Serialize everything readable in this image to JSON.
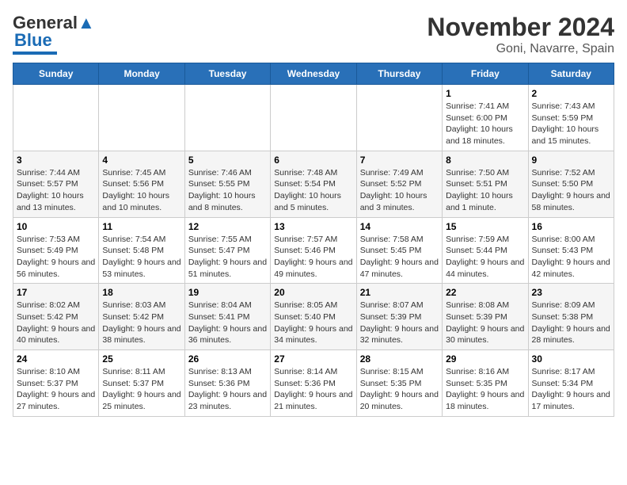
{
  "logo": {
    "line1": "General",
    "line2": "Blue"
  },
  "title": "November 2024",
  "subtitle": "Goni, Navarre, Spain",
  "weekdays": [
    "Sunday",
    "Monday",
    "Tuesday",
    "Wednesday",
    "Thursday",
    "Friday",
    "Saturday"
  ],
  "weeks": [
    [
      {
        "day": "",
        "info": ""
      },
      {
        "day": "",
        "info": ""
      },
      {
        "day": "",
        "info": ""
      },
      {
        "day": "",
        "info": ""
      },
      {
        "day": "",
        "info": ""
      },
      {
        "day": "1",
        "info": "Sunrise: 7:41 AM\nSunset: 6:00 PM\nDaylight: 10 hours and 18 minutes."
      },
      {
        "day": "2",
        "info": "Sunrise: 7:43 AM\nSunset: 5:59 PM\nDaylight: 10 hours and 15 minutes."
      }
    ],
    [
      {
        "day": "3",
        "info": "Sunrise: 7:44 AM\nSunset: 5:57 PM\nDaylight: 10 hours and 13 minutes."
      },
      {
        "day": "4",
        "info": "Sunrise: 7:45 AM\nSunset: 5:56 PM\nDaylight: 10 hours and 10 minutes."
      },
      {
        "day": "5",
        "info": "Sunrise: 7:46 AM\nSunset: 5:55 PM\nDaylight: 10 hours and 8 minutes."
      },
      {
        "day": "6",
        "info": "Sunrise: 7:48 AM\nSunset: 5:54 PM\nDaylight: 10 hours and 5 minutes."
      },
      {
        "day": "7",
        "info": "Sunrise: 7:49 AM\nSunset: 5:52 PM\nDaylight: 10 hours and 3 minutes."
      },
      {
        "day": "8",
        "info": "Sunrise: 7:50 AM\nSunset: 5:51 PM\nDaylight: 10 hours and 1 minute."
      },
      {
        "day": "9",
        "info": "Sunrise: 7:52 AM\nSunset: 5:50 PM\nDaylight: 9 hours and 58 minutes."
      }
    ],
    [
      {
        "day": "10",
        "info": "Sunrise: 7:53 AM\nSunset: 5:49 PM\nDaylight: 9 hours and 56 minutes."
      },
      {
        "day": "11",
        "info": "Sunrise: 7:54 AM\nSunset: 5:48 PM\nDaylight: 9 hours and 53 minutes."
      },
      {
        "day": "12",
        "info": "Sunrise: 7:55 AM\nSunset: 5:47 PM\nDaylight: 9 hours and 51 minutes."
      },
      {
        "day": "13",
        "info": "Sunrise: 7:57 AM\nSunset: 5:46 PM\nDaylight: 9 hours and 49 minutes."
      },
      {
        "day": "14",
        "info": "Sunrise: 7:58 AM\nSunset: 5:45 PM\nDaylight: 9 hours and 47 minutes."
      },
      {
        "day": "15",
        "info": "Sunrise: 7:59 AM\nSunset: 5:44 PM\nDaylight: 9 hours and 44 minutes."
      },
      {
        "day": "16",
        "info": "Sunrise: 8:00 AM\nSunset: 5:43 PM\nDaylight: 9 hours and 42 minutes."
      }
    ],
    [
      {
        "day": "17",
        "info": "Sunrise: 8:02 AM\nSunset: 5:42 PM\nDaylight: 9 hours and 40 minutes."
      },
      {
        "day": "18",
        "info": "Sunrise: 8:03 AM\nSunset: 5:42 PM\nDaylight: 9 hours and 38 minutes."
      },
      {
        "day": "19",
        "info": "Sunrise: 8:04 AM\nSunset: 5:41 PM\nDaylight: 9 hours and 36 minutes."
      },
      {
        "day": "20",
        "info": "Sunrise: 8:05 AM\nSunset: 5:40 PM\nDaylight: 9 hours and 34 minutes."
      },
      {
        "day": "21",
        "info": "Sunrise: 8:07 AM\nSunset: 5:39 PM\nDaylight: 9 hours and 32 minutes."
      },
      {
        "day": "22",
        "info": "Sunrise: 8:08 AM\nSunset: 5:39 PM\nDaylight: 9 hours and 30 minutes."
      },
      {
        "day": "23",
        "info": "Sunrise: 8:09 AM\nSunset: 5:38 PM\nDaylight: 9 hours and 28 minutes."
      }
    ],
    [
      {
        "day": "24",
        "info": "Sunrise: 8:10 AM\nSunset: 5:37 PM\nDaylight: 9 hours and 27 minutes."
      },
      {
        "day": "25",
        "info": "Sunrise: 8:11 AM\nSunset: 5:37 PM\nDaylight: 9 hours and 25 minutes."
      },
      {
        "day": "26",
        "info": "Sunrise: 8:13 AM\nSunset: 5:36 PM\nDaylight: 9 hours and 23 minutes."
      },
      {
        "day": "27",
        "info": "Sunrise: 8:14 AM\nSunset: 5:36 PM\nDaylight: 9 hours and 21 minutes."
      },
      {
        "day": "28",
        "info": "Sunrise: 8:15 AM\nSunset: 5:35 PM\nDaylight: 9 hours and 20 minutes."
      },
      {
        "day": "29",
        "info": "Sunrise: 8:16 AM\nSunset: 5:35 PM\nDaylight: 9 hours and 18 minutes."
      },
      {
        "day": "30",
        "info": "Sunrise: 8:17 AM\nSunset: 5:34 PM\nDaylight: 9 hours and 17 minutes."
      }
    ]
  ]
}
